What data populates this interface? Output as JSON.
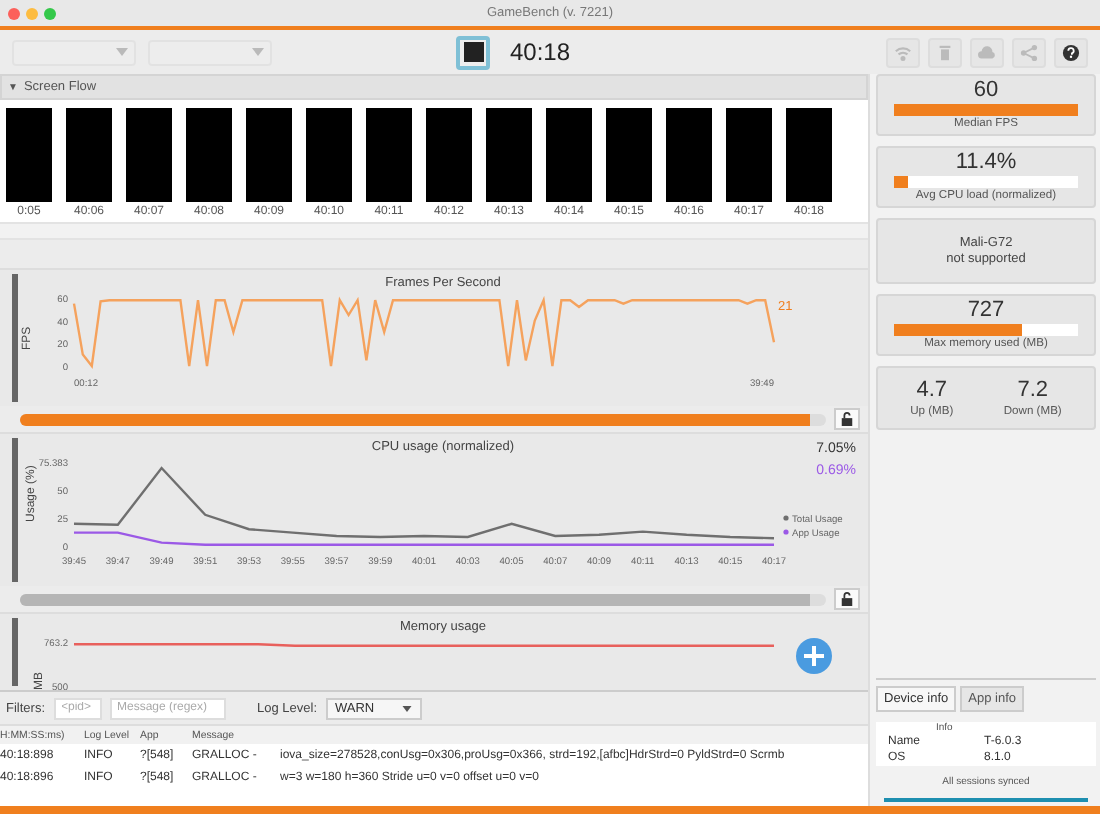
{
  "window": {
    "title": "GameBench (v. 7221)"
  },
  "toolbar": {
    "dropdowns": [
      {
        "disabled": true
      },
      {
        "disabled": true
      }
    ],
    "stop_button": {
      "kind": "stop"
    },
    "elapsed": "40:18",
    "icons": [
      {
        "kind": "wifi",
        "disabled": true
      },
      {
        "kind": "trash",
        "disabled": true
      },
      {
        "kind": "cloud",
        "disabled": true
      },
      {
        "kind": "share",
        "disabled": true
      },
      {
        "kind": "help",
        "disabled": false
      }
    ]
  },
  "screen_flow": {
    "toggle": "▼",
    "title": "Screen Flow",
    "expanded": true,
    "frames": [
      "0:05",
      "40:06",
      "40:07",
      "40:08",
      "40:09",
      "40:10",
      "40:11",
      "40:12",
      "40:13",
      "40:14",
      "40:15",
      "40:16",
      "40:17",
      "40:18"
    ]
  },
  "fps_panel": {
    "chart_data": {
      "type": "line",
      "title": "Frames Per Second",
      "ylabel": "FPS",
      "ylim": [
        0,
        60
      ],
      "yticks": [
        0,
        20,
        40,
        60
      ],
      "annotations": [
        "00:12",
        "39:49"
      ],
      "series": [
        {
          "color": "#f5a25d",
          "values": [
            55,
            10,
            0,
            57,
            58,
            58,
            58,
            58,
            58,
            58,
            58,
            58,
            58,
            0,
            58,
            0,
            58,
            58,
            30,
            58,
            58,
            58,
            58,
            58,
            58,
            58,
            58,
            58,
            58,
            0,
            58,
            45,
            58,
            5,
            58,
            30,
            58,
            58,
            58,
            58,
            58,
            58,
            58,
            58,
            58,
            58,
            58,
            58,
            58,
            0,
            58,
            5,
            40,
            58,
            0,
            58,
            58,
            52,
            58,
            58,
            58,
            58,
            55,
            58,
            58,
            58,
            58,
            58,
            58,
            58,
            58,
            58,
            58,
            58,
            58,
            58,
            55,
            58,
            58,
            21
          ]
        }
      ]
    },
    "current": "21",
    "slider": {
      "level": 0.98
    }
  },
  "cpu_panel": {
    "chart_data": {
      "type": "line",
      "title": "CPU usage (normalized)",
      "ylabel": "Usage (%)",
      "ylim": [
        0,
        75.383
      ],
      "yticks": [
        0,
        25,
        50,
        75.383
      ],
      "categories": [
        "39:45",
        "39:47",
        "39:49",
        "39:51",
        "39:53",
        "39:55",
        "39:57",
        "39:59",
        "40:01",
        "40:03",
        "40:05",
        "40:07",
        "40:09",
        "40:11",
        "40:13",
        "40:15",
        "40:17"
      ],
      "series": [
        {
          "name": "Total Usage",
          "color": "#6f6f6f",
          "values": [
            20,
            19,
            70,
            28,
            15,
            12,
            9,
            8,
            9,
            8,
            20,
            9,
            10,
            13,
            10,
            8,
            7
          ]
        },
        {
          "name": "App Usage",
          "color": "#9b59e6",
          "values": [
            12,
            12,
            3,
            1,
            1,
            1,
            1,
            1,
            1,
            1,
            1,
            1,
            1,
            1,
            1,
            1,
            1
          ]
        }
      ]
    },
    "readings": [
      {
        "text": "7.05%",
        "color": "#333333"
      },
      {
        "text": "0.69%",
        "color": "#9b59e6"
      }
    ],
    "slider": {
      "level": 0.98
    }
  },
  "memory_panel": {
    "chart_data": {
      "type": "line",
      "title": "Memory usage",
      "ylabel": "MB",
      "ylim": [
        500,
        763.2
      ],
      "yticks": [
        500,
        763.2
      ],
      "series": [
        {
          "color": "#e8605c",
          "values": [
            750,
            750,
            750,
            750,
            750,
            750,
            740,
            740,
            740,
            740,
            740,
            740,
            740,
            740,
            740,
            740,
            740,
            740,
            740,
            740
          ]
        }
      ]
    }
  },
  "filters": {
    "label": "Filters:",
    "pid_placeholder": "<pid>",
    "message_placeholder": "Message (regex)",
    "log_level_label": "Log Level:",
    "log_level": "WARN"
  },
  "log_table": {
    "columns": [
      "H:MM:SS:ms)",
      "Log Level",
      "App",
      "Message"
    ],
    "rows": [
      [
        "40:18:898",
        "INFO",
        "?[548]",
        "GRALLOC -",
        "iova_size=278528,conUsg=0x306,proUsg=0x366,   strd=192,[afbc]HdrStrd=0 PyldStrd=0 Scrmb"
      ],
      [
        "40:18:896",
        "INFO",
        "?[548]",
        "GRALLOC -",
        "w=3 w=180 h=360 Stride u=0 v=0 offset u=0 v=0"
      ]
    ]
  },
  "stats": [
    {
      "kind": "bar",
      "value": "60",
      "level": 1.0,
      "label": "Median FPS"
    },
    {
      "kind": "bar",
      "value": "11.4%",
      "level": 0.08,
      "label": "Avg CPU load (normalized)"
    },
    {
      "kind": "text",
      "lines": [
        "Mali-G72",
        "not supported"
      ]
    },
    {
      "kind": "bar",
      "value": "727",
      "level": 0.7,
      "label": "Max memory used (MB)"
    },
    {
      "kind": "pair",
      "items": [
        {
          "value": "4.7",
          "label": "Up (MB)"
        },
        {
          "value": "7.2",
          "label": "Down (MB)"
        }
      ]
    }
  ],
  "info_tabs": [
    {
      "label": "Device info",
      "selected": true
    },
    {
      "label": "App info",
      "selected": false
    }
  ],
  "info_table": {
    "header": "Info",
    "rows": [
      [
        "Name",
        "T-6.0.3"
      ],
      [
        "OS",
        "8.1.0"
      ]
    ]
  },
  "status": "All sessions synced"
}
